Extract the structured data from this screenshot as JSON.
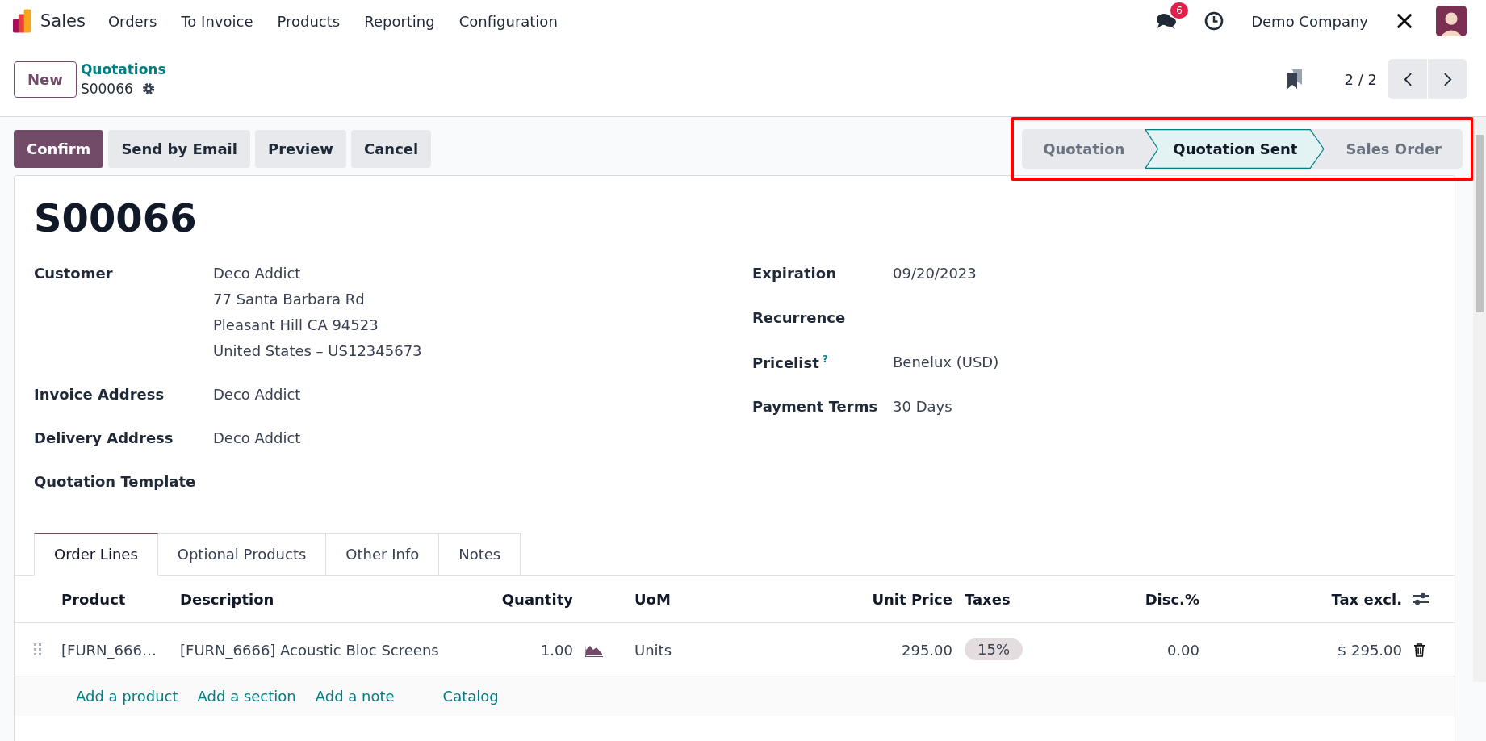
{
  "navbar": {
    "app": "Sales",
    "menu": [
      "Orders",
      "To Invoice",
      "Products",
      "Reporting",
      "Configuration"
    ],
    "messages_badge": "6",
    "company": "Demo Company"
  },
  "control_panel": {
    "new_button": "New",
    "breadcrumb": "Quotations",
    "record": "S00066",
    "pager": "2 / 2"
  },
  "actions": [
    {
      "label": "Confirm",
      "kind": "primary"
    },
    {
      "label": "Send by Email",
      "kind": "secondary"
    },
    {
      "label": "Preview",
      "kind": "secondary"
    },
    {
      "label": "Cancel",
      "kind": "secondary"
    }
  ],
  "status_bar": [
    {
      "label": "Quotation",
      "selected": false
    },
    {
      "label": "Quotation Sent",
      "selected": true
    },
    {
      "label": "Sales Order",
      "selected": false
    }
  ],
  "form": {
    "title": "S00066",
    "left_fields": [
      {
        "label": "Customer",
        "lines": [
          "Deco Addict",
          "77 Santa Barbara Rd",
          "Pleasant Hill CA 94523",
          "United States – US12345673"
        ]
      },
      {
        "label": "Invoice Address",
        "lines": [
          "Deco Addict"
        ]
      },
      {
        "label": "Delivery Address",
        "lines": [
          "Deco Addict"
        ]
      },
      {
        "label": "Quotation Template"
      }
    ],
    "right_fields": [
      {
        "label": "Expiration",
        "value": "09/20/2023"
      },
      {
        "label": "Recurrence"
      },
      {
        "label": "Pricelist",
        "help": "?",
        "value": "Benelux (USD)"
      },
      {
        "label": "Payment Terms",
        "value": "30 Days"
      }
    ]
  },
  "tabs": [
    {
      "label": "Order Lines",
      "selected": true
    },
    {
      "label": "Optional Products",
      "selected": false
    },
    {
      "label": "Other Info",
      "selected": false
    },
    {
      "label": "Notes",
      "selected": false
    }
  ],
  "table": {
    "columns": [
      "Product",
      "Description",
      "Quantity",
      "UoM",
      "Unit Price",
      "Taxes",
      "Disc.%",
      "Tax excl."
    ],
    "rows": [
      {
        "product": "[FURN_666…",
        "description": "[FURN_6666] Acoustic Bloc Screens",
        "quantity": "1.00",
        "uom": "Units",
        "unit_price": "295.00",
        "taxes": "15%",
        "discount": "0.00",
        "subtotal": "$ 295.00"
      }
    ],
    "add_links": [
      "Add a product",
      "Add a section",
      "Add a note",
      "Catalog"
    ]
  }
}
